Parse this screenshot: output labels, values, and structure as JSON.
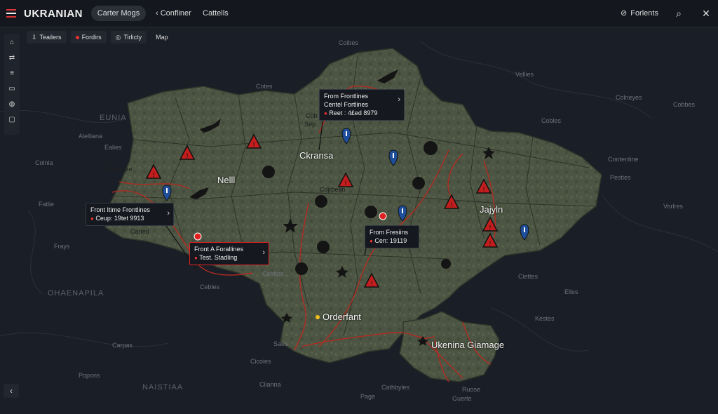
{
  "header": {
    "title": "UKRANIAN",
    "pill": "Carter Mogs",
    "back_label": "Confliner",
    "catalog_label": "Cattells",
    "right_label": "Forlents"
  },
  "chips": [
    {
      "label": "Teailers",
      "icon": "pin-icon"
    },
    {
      "label": "Fordirs",
      "icon": "dot-icon"
    },
    {
      "label": "Tirlicty",
      "icon": "globe-icon"
    },
    {
      "label": "Map",
      "icon": ""
    }
  ],
  "sidebar": [
    "layers-icon",
    "route-icon",
    "list-icon",
    "folder-icon",
    "globe-icon",
    "doc-icon"
  ],
  "map": {
    "region_labels": [
      {
        "text": "EUNIA",
        "cls": "label big"
      },
      {
        "text": "Alelliana",
        "cls": "label"
      },
      {
        "text": "Ealies",
        "cls": "label"
      },
      {
        "text": "Colnia",
        "cls": "label"
      },
      {
        "text": "Fatlie",
        "cls": "label"
      },
      {
        "text": "Frays",
        "cls": "label"
      },
      {
        "text": "OHAENAPILA",
        "cls": "label big"
      },
      {
        "text": "Carpas",
        "cls": "label"
      },
      {
        "text": "Popons",
        "cls": "label"
      },
      {
        "text": "NAISTIAA",
        "cls": "label big"
      },
      {
        "text": "Coibes",
        "cls": "label"
      },
      {
        "text": "Cotes",
        "cls": "label"
      },
      {
        "text": "Vellies",
        "cls": "label"
      },
      {
        "text": "Colneyes",
        "cls": "label"
      },
      {
        "text": "Cobbes",
        "cls": "label"
      },
      {
        "text": "Cobles",
        "cls": "label"
      },
      {
        "text": "Contentine",
        "cls": "label"
      },
      {
        "text": "Pesties",
        "cls": "label"
      },
      {
        "text": "Vorlres",
        "cls": "label"
      },
      {
        "text": "Ciettes",
        "cls": "label"
      },
      {
        "text": "Elles",
        "cls": "label"
      },
      {
        "text": "Kestes",
        "cls": "label"
      },
      {
        "text": "Cebltes",
        "cls": "label"
      },
      {
        "text": "Saes",
        "cls": "label"
      },
      {
        "text": "Cicoies",
        "cls": "label"
      },
      {
        "text": "Cathbyles",
        "cls": "label"
      },
      {
        "text": "Ruose",
        "cls": "label"
      },
      {
        "text": "Page",
        "cls": "label"
      },
      {
        "text": "Clianna",
        "cls": "label"
      },
      {
        "text": "Guerte",
        "cls": "label"
      },
      {
        "text": "Cebles",
        "cls": "label"
      }
    ],
    "city_labels": [
      {
        "text": "Ckransa"
      },
      {
        "text": "Nelll"
      },
      {
        "text": "Jajyln"
      },
      {
        "text": "Orderfant"
      },
      {
        "text": "Ukenina Giamage"
      }
    ],
    "minor_labels": [
      {
        "text": "Sutherltze"
      },
      {
        "text": "Carled"
      },
      {
        "text": "Cdjrbean"
      },
      {
        "text": "Cob"
      },
      {
        "text": "Sep"
      }
    ],
    "callouts": [
      {
        "line1": "From Frontlines",
        "line2": "Centel Fortlines",
        "line3": "Reet : 4£ed 8979",
        "name": "callout-north"
      },
      {
        "line1": "Front Itime Frontlines",
        "line2": "Ceup: 19tet 9913",
        "line3": "",
        "name": "callout-west"
      },
      {
        "line1": "Front A Forallines",
        "line2": "Test. Stadling",
        "line3": "",
        "name": "callout-southwest"
      },
      {
        "line1": "From Fresiins",
        "line2": "Cen: 19119",
        "line3": "",
        "name": "callout-east"
      }
    ],
    "colors": {
      "land": "#4a5341",
      "border": "#2e3329",
      "front": "#b22a22",
      "sea": "#1a1e26"
    }
  }
}
